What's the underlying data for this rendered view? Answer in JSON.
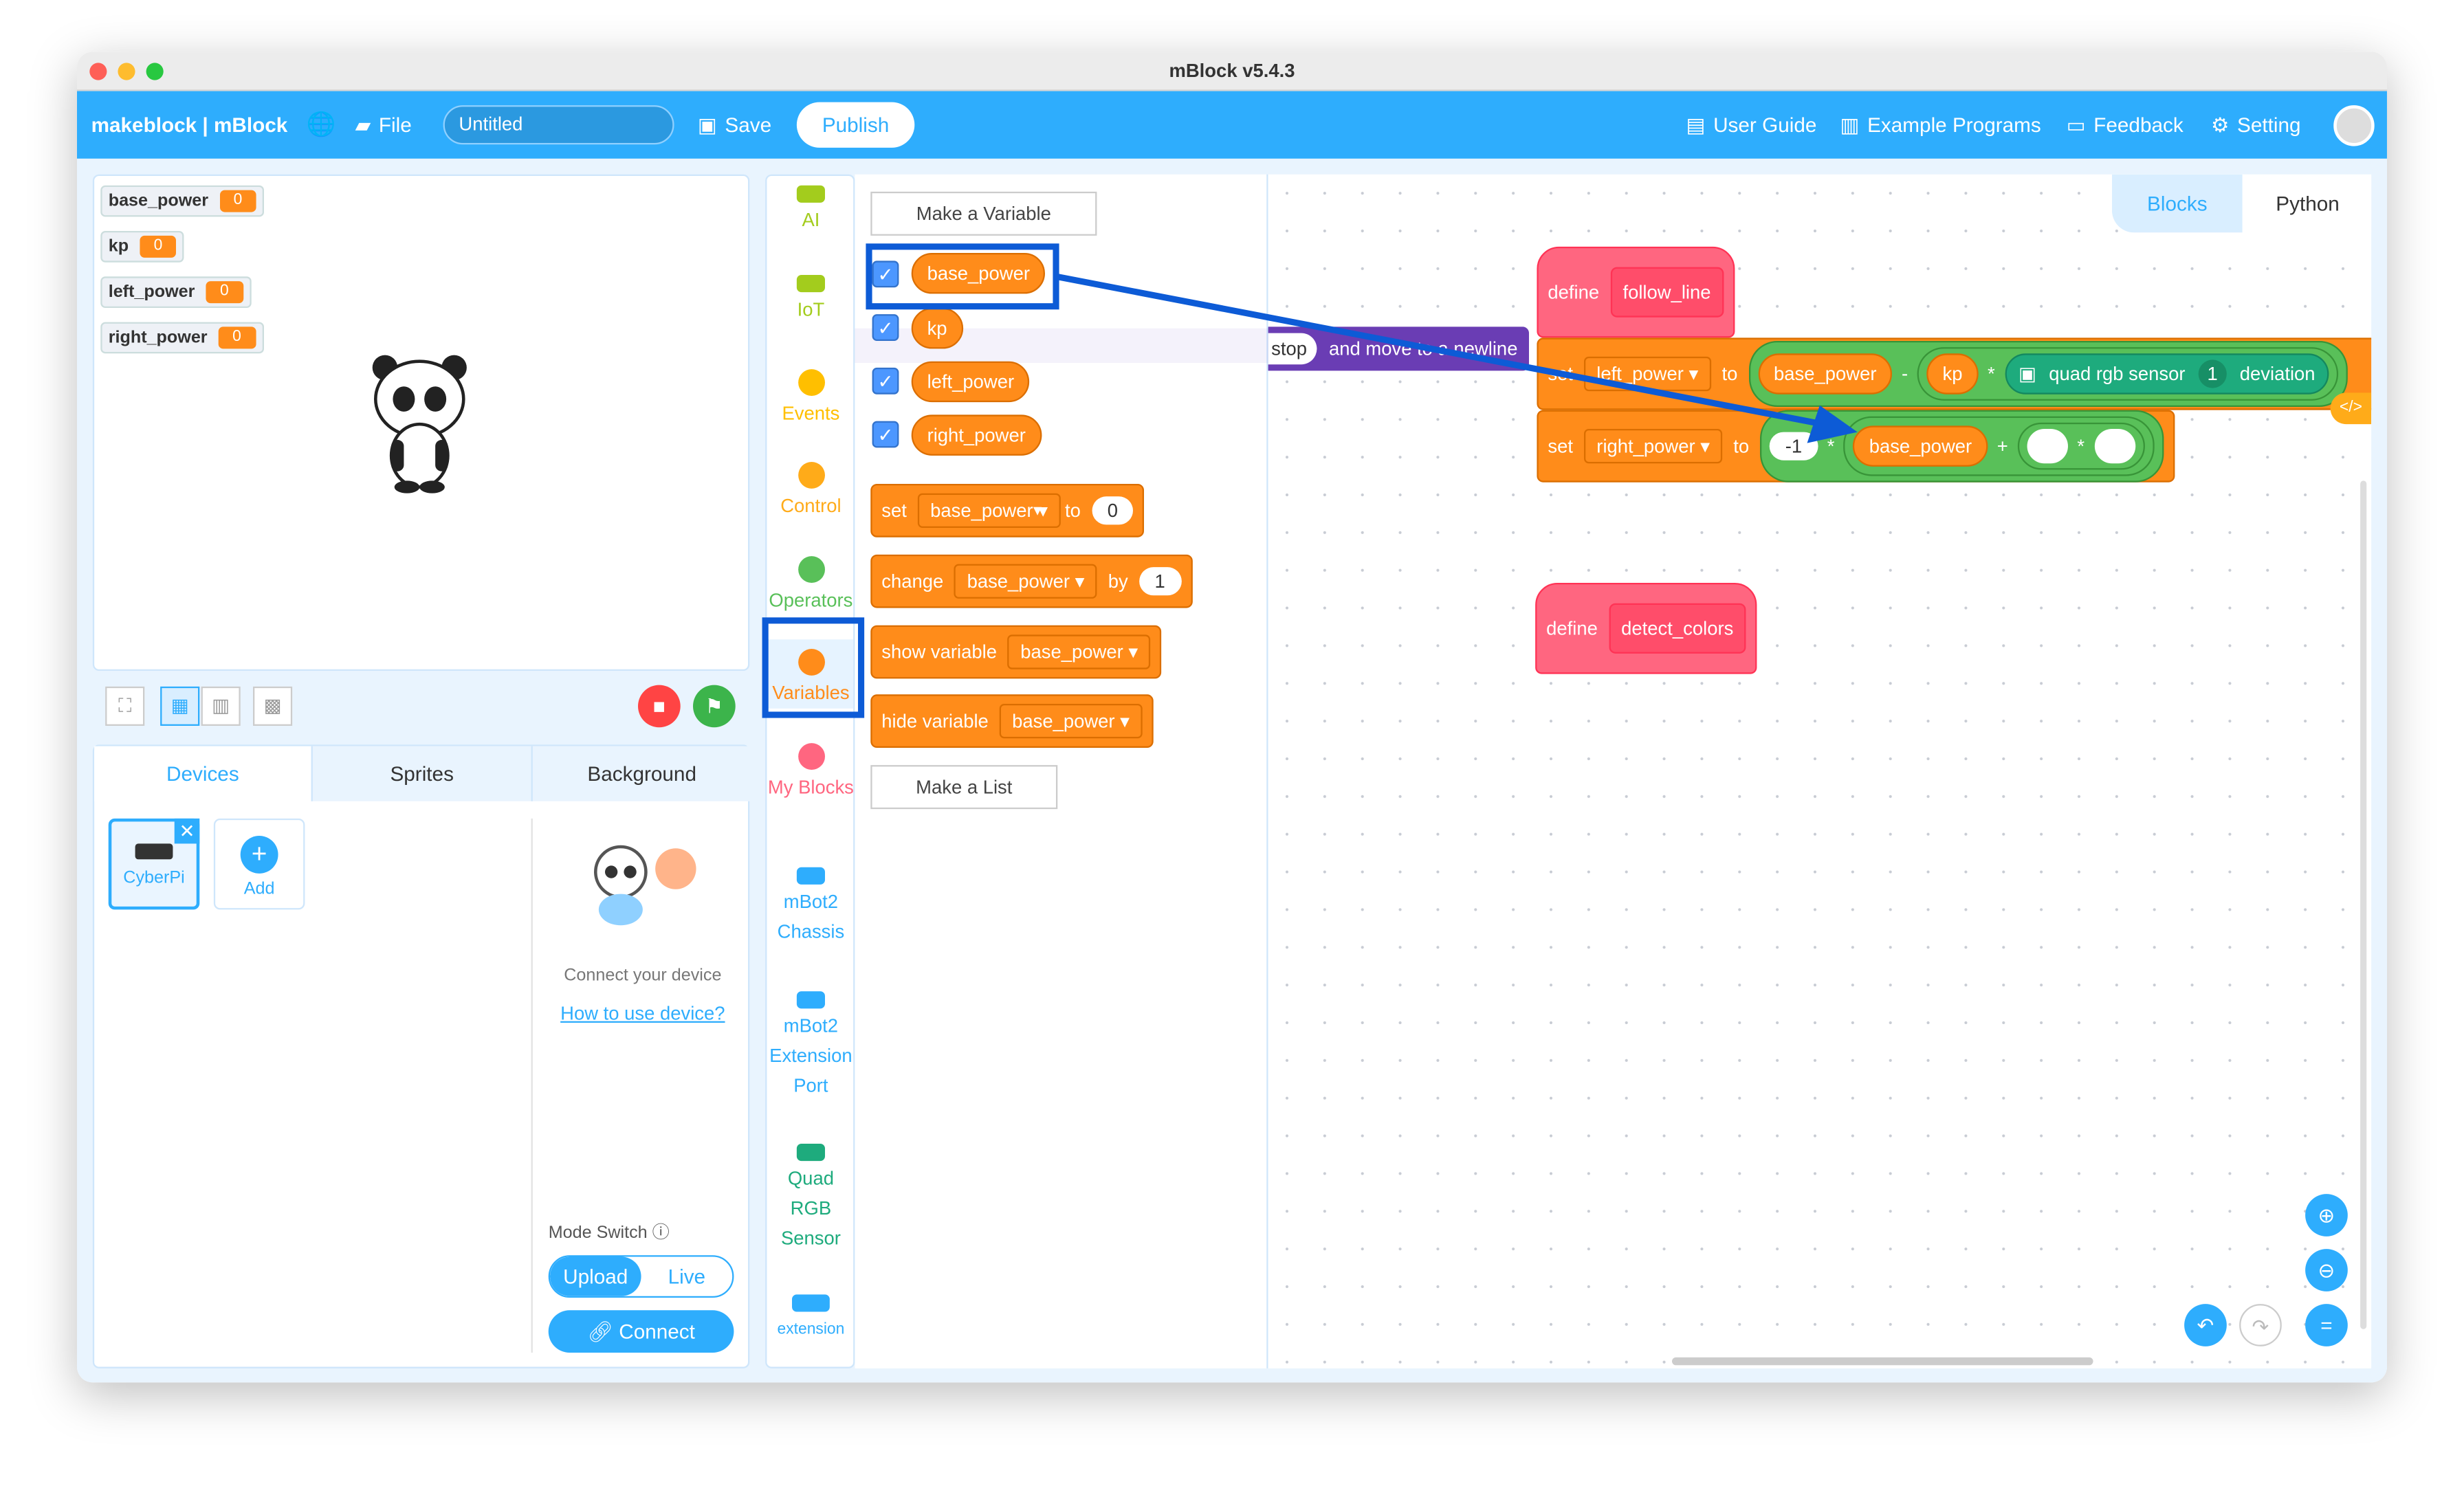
{
  "window": {
    "title": "mBlock v5.4.3"
  },
  "header": {
    "logo": "makeblock | mBlock",
    "file": "File",
    "project_name": "Untitled",
    "save": "Save",
    "publish": "Publish",
    "user_guide": "User Guide",
    "examples": "Example Programs",
    "feedback": "Feedback",
    "setting": "Setting"
  },
  "stage": {
    "monitors": [
      {
        "name": "base_power",
        "value": "0"
      },
      {
        "name": "kp",
        "value": "0"
      },
      {
        "name": "left_power",
        "value": "0"
      },
      {
        "name": "right_power",
        "value": "0"
      }
    ]
  },
  "tabs": {
    "devices": "Devices",
    "sprites": "Sprites",
    "background": "Background"
  },
  "devices": {
    "device": "CyberPi",
    "add": "Add",
    "connect_hint": "Connect your device",
    "how_to": "How to use device?",
    "mode_switch": "Mode Switch",
    "upload": "Upload",
    "live": "Live",
    "connect": "Connect"
  },
  "categories": [
    {
      "label": "AI",
      "color": "#a3cc1d"
    },
    {
      "label": "IoT",
      "color": "#a3cc1d"
    },
    {
      "label": "Events",
      "color": "#ffbf00"
    },
    {
      "label": "Control",
      "color": "#ffab19"
    },
    {
      "label": "Operators",
      "color": "#59c059"
    },
    {
      "label": "Variables",
      "color": "#ff8c1a"
    },
    {
      "label": "My Blocks",
      "color": "#ff6680"
    },
    {
      "label": "mBot2 Chassis",
      "color": "#2eadfd"
    },
    {
      "label": "mBot2 Extension Port",
      "color": "#2eadfd"
    },
    {
      "label": "Quad RGB Sensor",
      "color": "#1eab7d"
    },
    {
      "label": "extension",
      "color": "#2eadfd"
    }
  ],
  "flyout": {
    "make_variable": "Make a Variable",
    "variables": [
      "base_power",
      "kp",
      "left_power",
      "right_power"
    ],
    "set": {
      "label": "set",
      "var": "base_power",
      "to": "to",
      "value": "0"
    },
    "change": {
      "label": "change",
      "var": "base_power",
      "by": "by",
      "value": "1"
    },
    "show": {
      "label": "show variable",
      "var": "base_power"
    },
    "hide": {
      "label": "hide variable",
      "var": "base_power"
    },
    "make_list": "Make a List"
  },
  "workspace": {
    "view_tabs": {
      "blocks": "Blocks",
      "python": "Python"
    },
    "behind": {
      "stop": "stop",
      "rest": "and move to a newline"
    },
    "follow_line": {
      "define": "define",
      "name": "follow_line",
      "set1": {
        "label": "set",
        "var": "left_power",
        "to": "to",
        "a": "base_power",
        "minus": "-",
        "kp": "kp",
        "times": "*",
        "sensor": "quad rgb sensor",
        "port": "1",
        "tail": "deviation"
      },
      "set2": {
        "label": "set",
        "var": "right_power",
        "to": "to",
        "neg": "-1",
        "times": "*",
        "a": "base_power",
        "plus": "+",
        "times2": "*"
      }
    },
    "detect_colors": {
      "define": "define",
      "name": "detect_colors"
    }
  },
  "accent": "#2eadfd",
  "annotation_color": "#0d5bd6"
}
